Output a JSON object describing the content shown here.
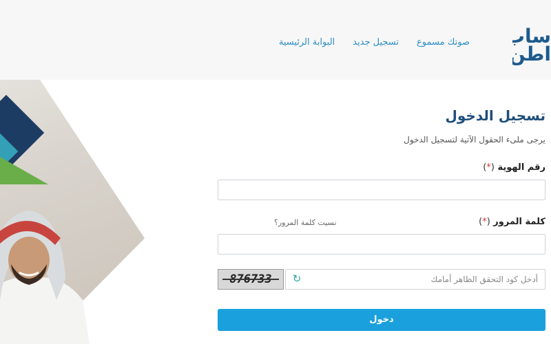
{
  "header": {
    "logo_line1": "ساب",
    "logo_line2": "اطن",
    "nav": [
      "البوابة الرئيسية",
      "تسجيل جديد",
      "صوتك مسموع"
    ]
  },
  "form": {
    "title": "تسجيل الدخول",
    "subtitle": "يرجى ملىء الحقول الآتية لتسجيل الدخول",
    "id_label": "رقم الهوية",
    "password_label": "كلمة المرور",
    "required_mark": "*",
    "forgot_link": "نسيت كلمة المرور؟",
    "id_value": "",
    "password_value": "",
    "captcha_placeholder": "أدخل كود التحقق الظاهر أمامك",
    "captcha_code": "876733",
    "login_button": "دخول"
  },
  "colors": {
    "accent": "#1aa0dc",
    "title": "#1e4e7a",
    "navy": "#1d3c63",
    "teal": "#33a0b8",
    "green": "#6aae4a"
  },
  "icons": {
    "refresh": "refresh-icon"
  }
}
